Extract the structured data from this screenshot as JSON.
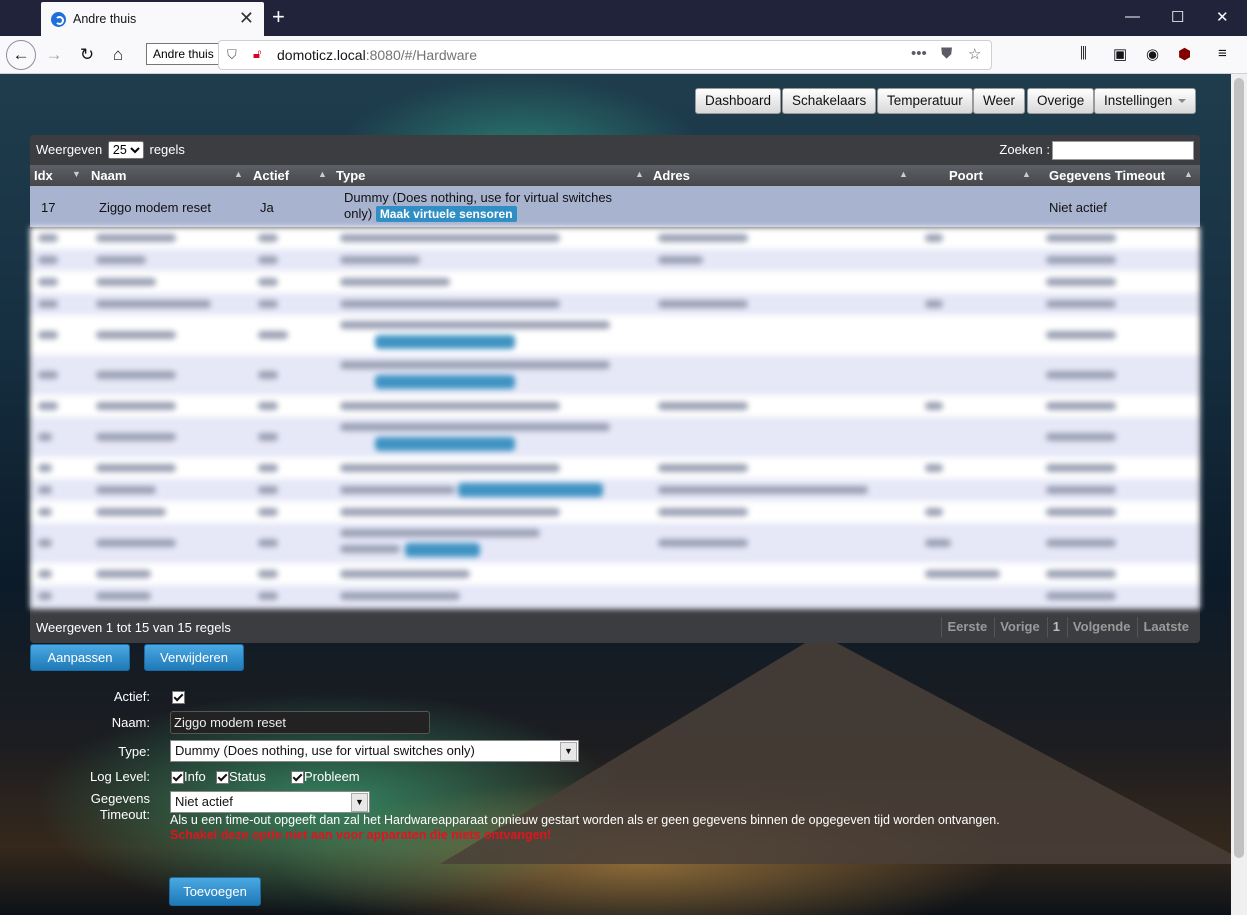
{
  "browser": {
    "tab_title": "Andre thuis",
    "tooltip": "Andre thuis",
    "url_host": "domoticz.local",
    "url_rest": ":8080/#/Hardware"
  },
  "menu": [
    "Dashboard",
    "Schakelaars",
    "Temperatuur",
    "Weer",
    "Overige",
    "Instellingen"
  ],
  "table": {
    "show_label": "Weergeven",
    "show_value": "25",
    "rows_label": "regels",
    "search_label": "Zoeken :",
    "columns": [
      "Idx",
      "Naam",
      "Actief",
      "Type",
      "Adres",
      "Poort",
      "Gegevens Timeout"
    ],
    "selected_row": {
      "idx": "17",
      "name": "Ziggo modem reset",
      "active": "Ja",
      "type_line1": "Dummy (Does nothing, use for virtual switches",
      "type_line2": "only)",
      "button": "Maak virtuele sensoren",
      "timeout": "Niet actief"
    },
    "footer": "Weergeven 1 tot 15 van 15 regels",
    "pager": [
      "Eerste",
      "Vorige",
      "1",
      "Volgende",
      "Laatste"
    ]
  },
  "actions": {
    "edit": "Aanpassen",
    "delete": "Verwijderen"
  },
  "form": {
    "active_label": "Actief:",
    "name_label": "Naam:",
    "name_value": "Ziggo modem reset",
    "type_label": "Type:",
    "type_value": "Dummy (Does nothing, use for virtual switches only)",
    "loglevel_label": "Log Level:",
    "log_info": "Info",
    "log_status": "Status",
    "log_problem": "Probleem",
    "timeout_label_1": "Gegevens",
    "timeout_label_2": "Timeout:",
    "timeout_value": "Niet actief",
    "help_text": "Als u een time-out opgeeft dan zal het Hardwareapparaat opnieuw gestart worden als er geen gegevens binnen de opgegeven tijd worden ontvangen.",
    "warning_text": "Schakel deze optie niet aan voor apparaten die niets ontvangen!",
    "add_button": "Toevoegen"
  }
}
